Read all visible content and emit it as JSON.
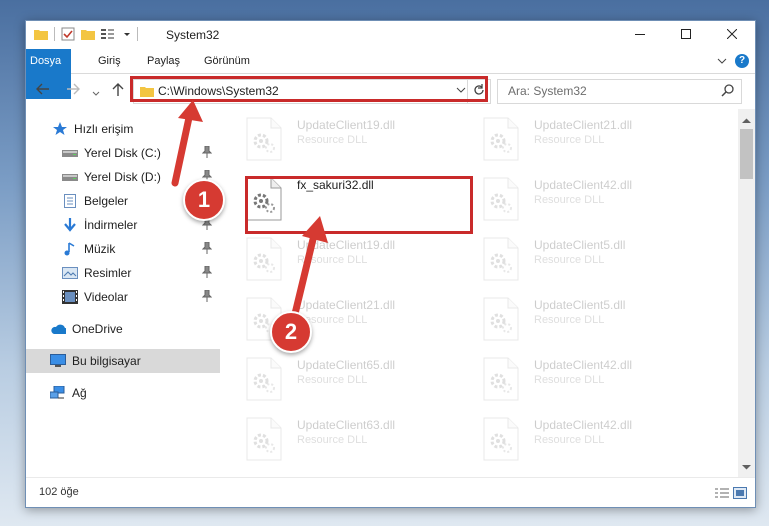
{
  "window": {
    "title": "System32",
    "controls": {
      "minimize": "minimize-icon",
      "maximize": "maximize-icon",
      "close": "close-icon"
    }
  },
  "ribbon": {
    "tabs": [
      {
        "label": "Dosya",
        "active": true
      },
      {
        "label": "Giriş"
      },
      {
        "label": "Paylaş"
      },
      {
        "label": "Görünüm"
      }
    ]
  },
  "address": {
    "path": "C:\\Windows\\System32"
  },
  "search": {
    "placeholder": "Ara: System32"
  },
  "sidebar": {
    "items": [
      {
        "label": "Hızlı erişim",
        "icon": "star-icon",
        "pinned": false
      },
      {
        "label": "Yerel Disk (C:)",
        "icon": "drive-icon",
        "pinned": true
      },
      {
        "label": "Yerel Disk (D:)",
        "icon": "drive-icon",
        "pinned": true
      },
      {
        "label": "Belgeler",
        "icon": "document-icon",
        "pinned": true
      },
      {
        "label": "İndirmeler",
        "icon": "download-icon",
        "pinned": true
      },
      {
        "label": "Müzik",
        "icon": "music-icon",
        "pinned": true
      },
      {
        "label": "Resimler",
        "icon": "picture-icon",
        "pinned": true
      },
      {
        "label": "Videolar",
        "icon": "video-icon",
        "pinned": true
      },
      {
        "label": "OneDrive",
        "icon": "cloud-icon",
        "pinned": false
      },
      {
        "label": "Bu bilgisayar",
        "icon": "computer-icon",
        "pinned": false,
        "selected": true
      },
      {
        "label": "Ağ",
        "icon": "network-icon",
        "pinned": false
      }
    ]
  },
  "files": [
    {
      "name": "UpdateClient19.dll",
      "type": "Resource DLL"
    },
    {
      "name": "UpdateClient21.dll",
      "type": "Resource DLL"
    },
    {
      "name": "fx_sakuri32.dll",
      "type": ""
    },
    {
      "name": "UpdateClient42.dll",
      "type": "Resource DLL"
    },
    {
      "name": "UpdateClient19.dll",
      "type": "Resource DLL"
    },
    {
      "name": "UpdateClient5.dll",
      "type": "Resource DLL"
    },
    {
      "name": "UpdateClient21.dll",
      "type": "Resource DLL"
    },
    {
      "name": "UpdateClient5.dll",
      "type": "Resource DLL"
    },
    {
      "name": "UpdateClient65.dll",
      "type": "Resource DLL"
    },
    {
      "name": "UpdateClient42.dll",
      "type": "Resource DLL"
    },
    {
      "name": "UpdateClient63.dll",
      "type": "Resource DLL"
    },
    {
      "name": "UpdateClient42.dll",
      "type": "Resource DLL"
    }
  ],
  "status": {
    "item_count": "102 öğe"
  },
  "annotations": {
    "step1": "1",
    "step2": "2",
    "color": "#d63a32"
  }
}
